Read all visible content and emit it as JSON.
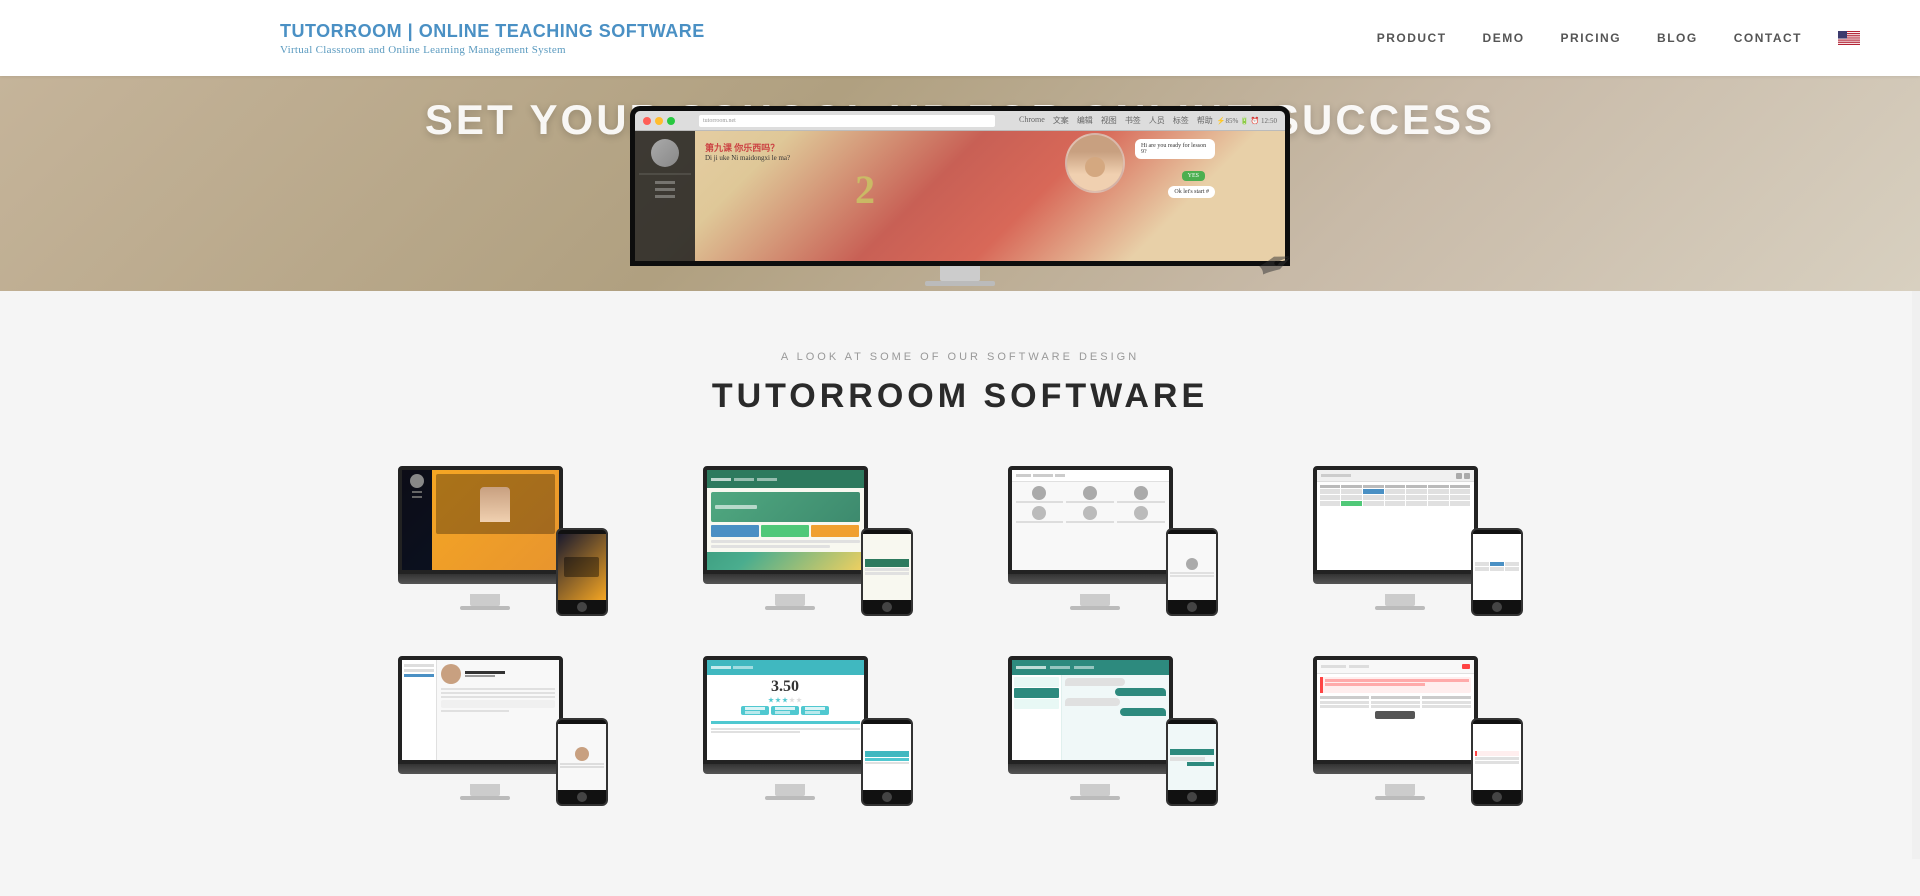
{
  "header": {
    "logo_title_start": "TUTORROOM | ",
    "logo_title_end": "ONLINE TEACHING SOFTWARE",
    "logo_subtitle": "Virtual Classroom and Online Learning Management System",
    "nav": {
      "items": [
        {
          "label": "PRODUCT",
          "id": "product"
        },
        {
          "label": "DEMO",
          "id": "demo"
        },
        {
          "label": "PRICING",
          "id": "pricing"
        },
        {
          "label": "BLOG",
          "id": "blog"
        },
        {
          "label": "CONTACT",
          "id": "contact"
        }
      ]
    }
  },
  "hero": {
    "title": "SET YOUR SCHOOL UP FOR ONLINE SUCCESS"
  },
  "section": {
    "subtitle": "A LOOK AT SOME OF OUR SOFTWARE DESIGN",
    "title": "TUTORROOM SOFTWARE"
  },
  "grid": {
    "items": [
      {
        "id": "item-1",
        "screen_class": "screen-1"
      },
      {
        "id": "item-2",
        "screen_class": "screen-2"
      },
      {
        "id": "item-3",
        "screen_class": "screen-3"
      },
      {
        "id": "item-4",
        "screen_class": "screen-4"
      },
      {
        "id": "item-5",
        "screen_class": "screen-5"
      },
      {
        "id": "item-6",
        "screen_class": "screen-6"
      },
      {
        "id": "item-7",
        "screen_class": "screen-7"
      },
      {
        "id": "item-8",
        "screen_class": "screen-8"
      }
    ]
  },
  "colors": {
    "logo_blue": "#4a90c4",
    "nav_text": "#555555",
    "hero_overlay": "rgba(255,255,255,0.92)",
    "section_bg": "#f5f5f5",
    "title_color": "#2a2a2a"
  }
}
